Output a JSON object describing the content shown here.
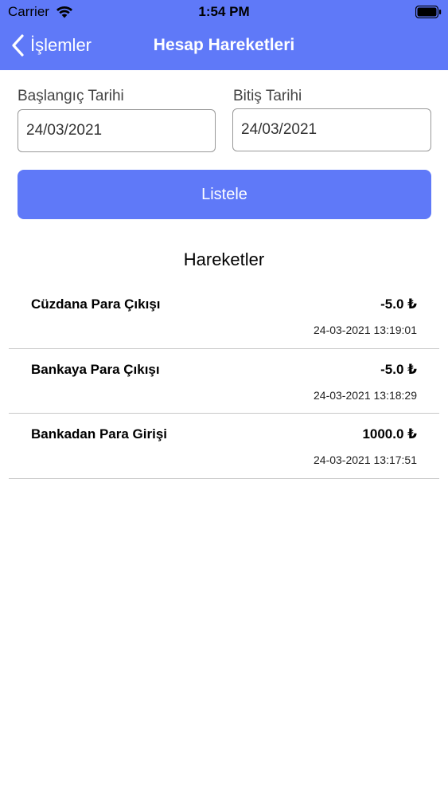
{
  "status_bar": {
    "carrier": "Carrier",
    "time": "1:54 PM"
  },
  "nav": {
    "back_label": "İşlemler",
    "title": "Hesap Hareketleri"
  },
  "form": {
    "start_label": "Başlangıç Tarihi",
    "start_value": "24/03/2021",
    "end_label": "Bitiş Tarihi",
    "end_value": "24/03/2021",
    "submit_label": "Listele"
  },
  "transactions": {
    "title": "Hareketler",
    "items": [
      {
        "name": "Cüzdana Para Çıkışı",
        "amount": "-5.0 ₺",
        "datetime": "24-03-2021 13:19:01"
      },
      {
        "name": "Bankaya Para Çıkışı",
        "amount": "-5.0 ₺",
        "datetime": "24-03-2021 13:18:29"
      },
      {
        "name": "Bankadan Para Girişi",
        "amount": "1000.0 ₺",
        "datetime": "24-03-2021 13:17:51"
      }
    ]
  },
  "colors": {
    "accent": "#5f79f8",
    "divider": "#c8c8c8"
  },
  "icons": [
    "wifi-icon",
    "battery-icon",
    "chevron-left-icon"
  ]
}
